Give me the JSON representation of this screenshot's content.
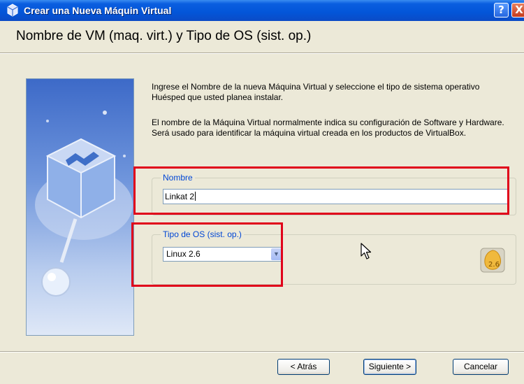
{
  "window": {
    "title": "Crear una Nueva Máquin Virtual",
    "help_label": "?",
    "close_label": "X"
  },
  "heading": "Nombre de VM (maq. virt.) y Tipo de OS (sist. op.)",
  "description": [
    "Ingrese el Nombre de la nueva Máquina Virtual y seleccione el tipo de sistema operativo Huésped que usted planea instalar.",
    "El nombre de la Máquina Virtual normalmente indica su configuración de Software y Hardware. Será usado para identificar la máquina virtual creada en los productos de VirtualBox."
  ],
  "name_group": {
    "legend": "Nombre",
    "value": "Linkat 2"
  },
  "os_group": {
    "legend": "Tipo de OS (sist. op.)",
    "selected": "Linux 2.6",
    "icon_label": "2.6"
  },
  "buttons": {
    "back": "< Atrás",
    "next": "Siguiente >",
    "cancel": "Cancelar"
  },
  "icons": {
    "title": "virtualbox-icon",
    "side": "virtualbox-logo-icon",
    "os": "linux-os-icon",
    "dropdown": "chevron-down-icon",
    "cursor": "mouse-cursor-icon"
  },
  "colors": {
    "highlight": "#e0001a",
    "titlebar": "#0355d8",
    "legend_text": "#0046d5"
  }
}
